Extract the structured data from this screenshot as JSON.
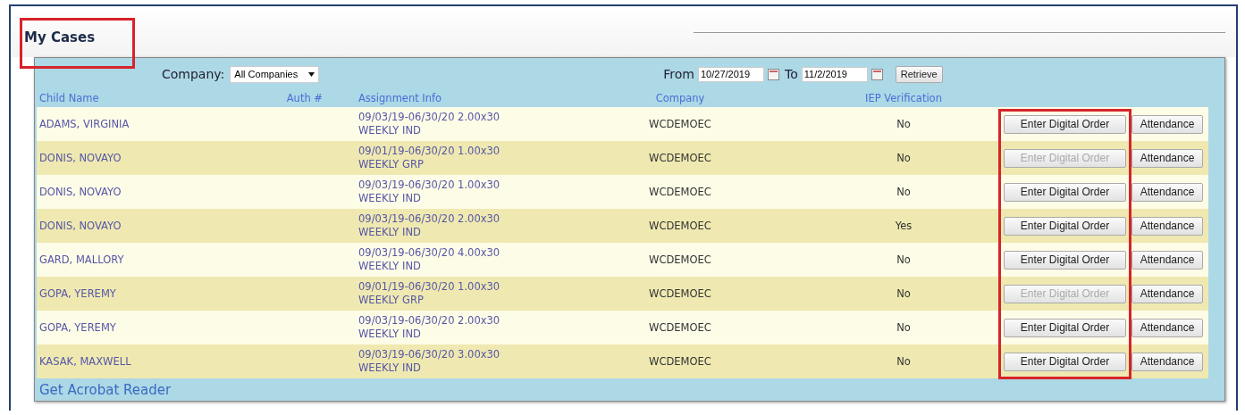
{
  "title": "My Cases",
  "filter": {
    "company_label": "Company:",
    "company_value": "All Companies",
    "from_label": "From",
    "from_value": "10/27/2019",
    "to_label": "To",
    "to_value": "11/2/2019",
    "retrieve": "Retrieve"
  },
  "columns": [
    "Child Name",
    "Auth #",
    "Assignment Info",
    "Company",
    "IEP Verification"
  ],
  "rows": [
    {
      "child": "ADAMS, VIRGINIA",
      "assignment": [
        "09/03/19-06/30/20 2.00x30",
        "WEEKLY IND"
      ],
      "company": "WCDEMOEC",
      "iep": "No",
      "order_button": {
        "label": "Enter Digital Order",
        "disabled": false
      },
      "attendance": "Attendance"
    },
    {
      "child": "DONIS, NOVAYO",
      "assignment": [
        "09/01/19-06/30/20 1.00x30",
        "WEEKLY GRP"
      ],
      "company": "WCDEMOEC",
      "iep": "No",
      "order_button": {
        "label": "Enter Digital Order",
        "disabled": true
      },
      "attendance": "Attendance"
    },
    {
      "child": "DONIS, NOVAYO",
      "assignment": [
        "09/03/19-06/30/20 1.00x30",
        "WEEKLY IND"
      ],
      "company": "WCDEMOEC",
      "iep": "No",
      "order_button": {
        "label": "Enter Digital Order",
        "disabled": false
      },
      "attendance": "Attendance"
    },
    {
      "child": "DONIS, NOVAYO",
      "assignment": [
        "09/03/19-06/30/20 2.00x30",
        "WEEKLY IND"
      ],
      "company": "WCDEMOEC",
      "iep": "Yes",
      "order_button": {
        "label": "Enter Digital Order",
        "disabled": false
      },
      "attendance": "Attendance"
    },
    {
      "child": "GARD, MALLORY",
      "assignment": [
        "09/03/19-06/30/20 4.00x30",
        "WEEKLY IND"
      ],
      "company": "WCDEMOEC",
      "iep": "No",
      "order_button": {
        "label": "Enter Digital Order",
        "disabled": false
      },
      "attendance": "Attendance"
    },
    {
      "child": "GOPA, YEREMY",
      "assignment": [
        "09/01/19-06/30/20 1.00x30",
        "WEEKLY GRP"
      ],
      "company": "WCDEMOEC",
      "iep": "No",
      "order_button": {
        "label": "Enter Digital Order",
        "disabled": true
      },
      "attendance": "Attendance"
    },
    {
      "child": "GOPA, YEREMY",
      "assignment": [
        "09/03/19-06/30/20 2.00x30",
        "WEEKLY IND"
      ],
      "company": "WCDEMOEC",
      "iep": "No",
      "order_button": {
        "label": "Enter Digital Order",
        "disabled": false
      },
      "attendance": "Attendance"
    },
    {
      "child": "KASAK, MAXWELL",
      "assignment": [
        "09/03/19-06/30/20 3.00x30",
        "WEEKLY IND"
      ],
      "company": "WCDEMOEC",
      "iep": "No",
      "order_button": {
        "label": "Enter Digital Order",
        "disabled": false
      },
      "attendance": "Attendance"
    }
  ],
  "footer_link": "Get Acrobat Reader"
}
